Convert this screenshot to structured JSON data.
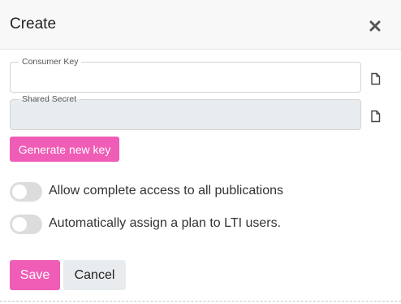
{
  "dialog": {
    "title": "Create"
  },
  "fields": {
    "consumer_key": {
      "label": "Consumer Key",
      "value": ""
    },
    "shared_secret": {
      "label": "Shared Secret",
      "value": ""
    }
  },
  "actions": {
    "generate_label": "Generate new key",
    "save_label": "Save",
    "cancel_label": "Cancel"
  },
  "toggles": [
    {
      "label": "Allow complete access to all publications",
      "checked": false
    },
    {
      "label": "Automatically assign a plan to LTI users.",
      "checked": false
    }
  ],
  "colors": {
    "accent": "#ef5db6",
    "toggle_off": "#dcdcdc",
    "secondary_button": "#e9ecef"
  },
  "icons": {
    "close": "close-icon",
    "copy": "copy-icon"
  }
}
